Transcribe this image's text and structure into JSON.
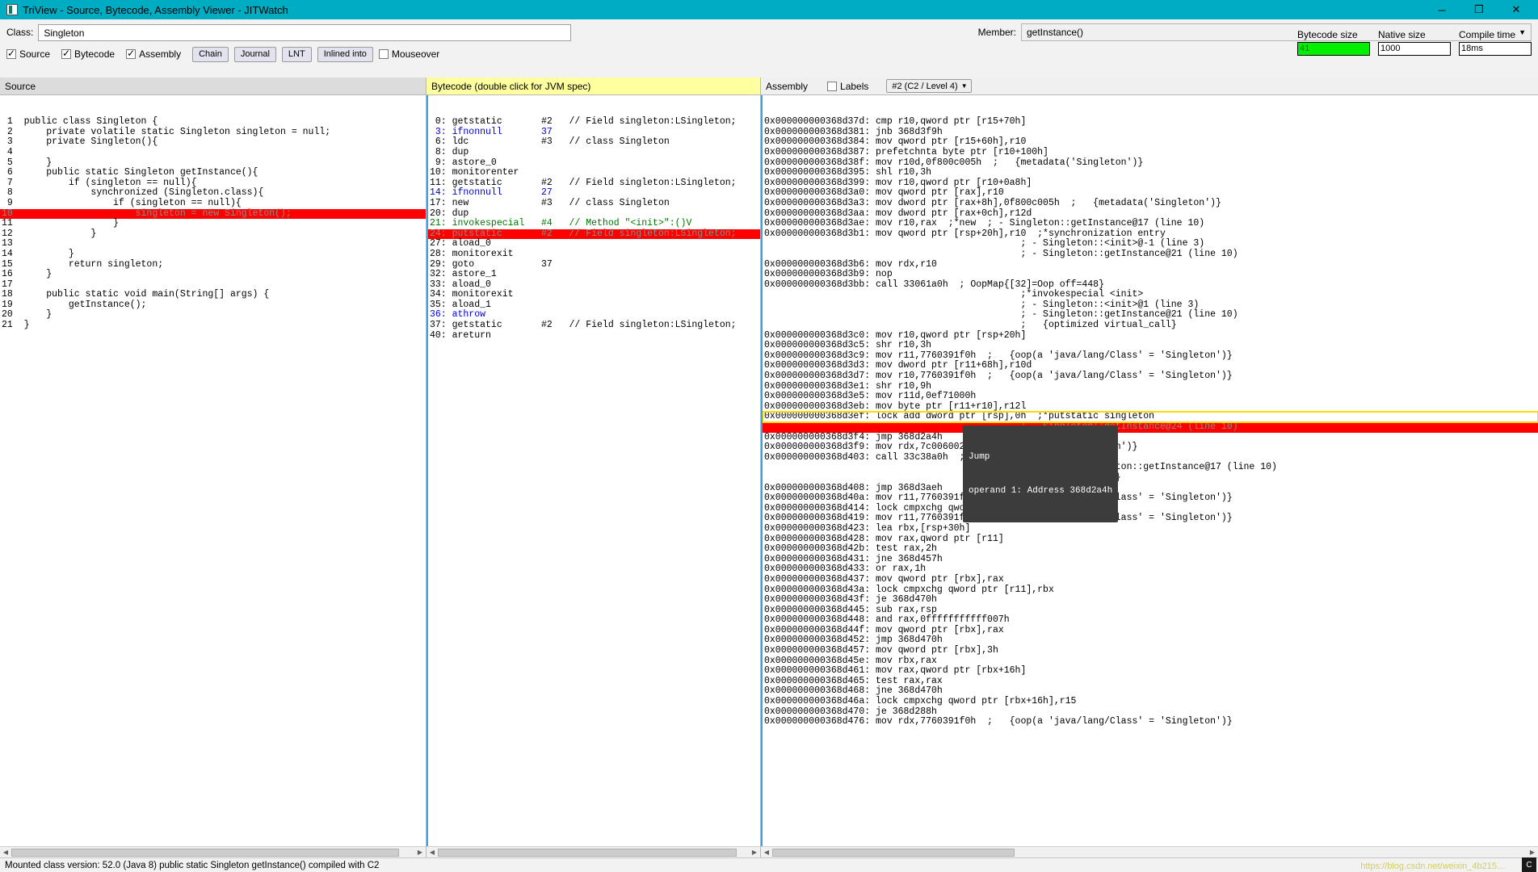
{
  "window": {
    "title": "TriView - Source, Bytecode, Assembly Viewer - JITWatch",
    "minimize": "─",
    "maximize": "❐",
    "close": "✕"
  },
  "toolbar": {
    "class_label": "Class:",
    "class_value": "Singleton",
    "member_label": "Member:",
    "member_value": "getInstance()",
    "member_arrow": "▼",
    "checkboxes": [
      {
        "label": "Source",
        "checked": true
      },
      {
        "label": "Bytecode",
        "checked": true
      },
      {
        "label": "Assembly",
        "checked": true
      }
    ],
    "mouseover": {
      "label": "Mouseover",
      "checked": false
    },
    "buttons": [
      "Chain",
      "Journal",
      "LNT",
      "Inlined into"
    ],
    "metrics": [
      {
        "label": "Bytecode size",
        "value": "41",
        "highlight": "#00f000"
      },
      {
        "label": "Native size",
        "value": "1000",
        "highlight": ""
      },
      {
        "label": "Compile time",
        "value": "18ms",
        "highlight": ""
      }
    ]
  },
  "source_panel": {
    "header": "Source",
    "highlight_line": 10,
    "lines": [
      {
        "n": "1",
        "text": "public class Singleton {"
      },
      {
        "n": "2",
        "text": "    private volatile static Singleton singleton = null;"
      },
      {
        "n": "3",
        "text": "    private Singleton(){"
      },
      {
        "n": "4",
        "text": ""
      },
      {
        "n": "5",
        "text": "    }"
      },
      {
        "n": "6",
        "text": "    public static Singleton getInstance(){"
      },
      {
        "n": "7",
        "text": "        if (singleton == null){"
      },
      {
        "n": "8",
        "text": "            synchronized (Singleton.class){"
      },
      {
        "n": "9",
        "text": "                if (singleton == null){"
      },
      {
        "n": "10",
        "text": "                    singleton = new Singleton();"
      },
      {
        "n": "11",
        "text": "                }"
      },
      {
        "n": "12",
        "text": "            }"
      },
      {
        "n": "13",
        "text": ""
      },
      {
        "n": "14",
        "text": "        }"
      },
      {
        "n": "15",
        "text": "        return singleton;"
      },
      {
        "n": "16",
        "text": "    }"
      },
      {
        "n": "17",
        "text": ""
      },
      {
        "n": "18",
        "text": "    public static void main(String[] args) {"
      },
      {
        "n": "19",
        "text": "        getInstance();"
      },
      {
        "n": "20",
        "text": "    }"
      },
      {
        "n": "21",
        "text": "}"
      }
    ]
  },
  "bytecode_panel": {
    "header": "Bytecode (double click for JVM spec)",
    "highlight_offset": "24",
    "lines": [
      {
        "offset": " 0:",
        "op": "getstatic",
        "arg": "#2",
        "comment": "// Field singleton:LSingleton;",
        "color": "black"
      },
      {
        "offset": " 3:",
        "op": "ifnonnull",
        "arg": "37",
        "comment": "",
        "color": "blue"
      },
      {
        "offset": " 6:",
        "op": "ldc",
        "arg": "#3",
        "comment": "// class Singleton",
        "color": "black"
      },
      {
        "offset": " 8:",
        "op": "dup",
        "arg": "",
        "comment": "",
        "color": "black"
      },
      {
        "offset": " 9:",
        "op": "astore_0",
        "arg": "",
        "comment": "",
        "color": "black"
      },
      {
        "offset": "10:",
        "op": "monitorenter",
        "arg": "",
        "comment": "",
        "color": "black"
      },
      {
        "offset": "11:",
        "op": "getstatic",
        "arg": "#2",
        "comment": "// Field singleton:LSingleton;",
        "color": "black"
      },
      {
        "offset": "14:",
        "op": "ifnonnull",
        "arg": "27",
        "comment": "",
        "color": "blue"
      },
      {
        "offset": "17:",
        "op": "new",
        "arg": "#3",
        "comment": "// class Singleton",
        "color": "black"
      },
      {
        "offset": "20:",
        "op": "dup",
        "arg": "",
        "comment": "",
        "color": "black"
      },
      {
        "offset": "21:",
        "op": "invokespecial",
        "arg": "#4",
        "comment": "// Method \"<init>\":()V",
        "color": "green"
      },
      {
        "offset": "24:",
        "op": "putstatic",
        "arg": "#2",
        "comment": "// Field singleton:LSingleton;",
        "color": "black",
        "highlight": true
      },
      {
        "offset": "27:",
        "op": "aload_0",
        "arg": "",
        "comment": "",
        "color": "black"
      },
      {
        "offset": "28:",
        "op": "monitorexit",
        "arg": "",
        "comment": "",
        "color": "black"
      },
      {
        "offset": "29:",
        "op": "goto",
        "arg": "37",
        "comment": "",
        "color": "black"
      },
      {
        "offset": "32:",
        "op": "astore_1",
        "arg": "",
        "comment": "",
        "color": "black"
      },
      {
        "offset": "33:",
        "op": "aload_0",
        "arg": "",
        "comment": "",
        "color": "black"
      },
      {
        "offset": "34:",
        "op": "monitorexit",
        "arg": "",
        "comment": "",
        "color": "black"
      },
      {
        "offset": "35:",
        "op": "aload_1",
        "arg": "",
        "comment": "",
        "color": "black"
      },
      {
        "offset": "36:",
        "op": "athrow",
        "arg": "",
        "comment": "",
        "color": "blue"
      },
      {
        "offset": "37:",
        "op": "getstatic",
        "arg": "#2",
        "comment": "// Field singleton:LSingleton;",
        "color": "black"
      },
      {
        "offset": "40:",
        "op": "areturn",
        "arg": "",
        "comment": "",
        "color": "black"
      }
    ]
  },
  "assembly_panel": {
    "header": "Assembly",
    "labels_checkbox": {
      "label": "Labels",
      "checked": false
    },
    "compilation_selector": "#2  (C2 / Level 4)",
    "selector_arrow": "▼",
    "highlight_yellow_address": "0x000000000368d3ef",
    "lines": [
      {
        "text": "0x000000000368d37d: cmp r10,qword ptr [r15+70h]",
        "clip_top": true
      },
      {
        "text": "0x000000000368d381: jnb 368d3f9h"
      },
      {
        "text": "0x000000000368d384: mov qword ptr [r15+60h],r10"
      },
      {
        "text": "0x000000000368d387: prefetchnta byte ptr [r10+100h]"
      },
      {
        "text": "0x000000000368d38f: mov r10d,0f800c005h  ;   {metadata('Singleton')}"
      },
      {
        "text": "0x000000000368d395: shl r10,3h"
      },
      {
        "text": "0x000000000368d399: mov r10,qword ptr [r10+0a8h]"
      },
      {
        "text": "0x000000000368d3a0: mov qword ptr [rax],r10"
      },
      {
        "text": "0x000000000368d3a3: mov dword ptr [rax+8h],0f800c005h  ;   {metadata('Singleton')}"
      },
      {
        "text": "0x000000000368d3aa: mov dword ptr [rax+0ch],r12d"
      },
      {
        "text": "0x000000000368d3ae: mov r10,rax  ;*new  ; - Singleton::getInstance@17 (line 10)"
      },
      {
        "text": "0x000000000368d3b1: mov qword ptr [rsp+20h],r10  ;*synchronization entry"
      },
      {
        "text": "                                              ; - Singleton::<init>@-1 (line 3)"
      },
      {
        "text": "                                              ; - Singleton::getInstance@21 (line 10)"
      },
      {
        "text": "0x000000000368d3b6: mov rdx,r10"
      },
      {
        "text": "0x000000000368d3b9: nop"
      },
      {
        "text": "0x000000000368d3bb: call 33061a0h  ; OopMap{[32]=Oop off=448}"
      },
      {
        "text": "                                              ;*invokespecial <init>"
      },
      {
        "text": "                                              ; - Singleton::<init>@1 (line 3)"
      },
      {
        "text": "                                              ; - Singleton::getInstance@21 (line 10)"
      },
      {
        "text": "                                              ;   {optimized virtual_call}"
      },
      {
        "text": "0x000000000368d3c0: mov r10,qword ptr [rsp+20h]"
      },
      {
        "text": "0x000000000368d3c5: shr r10,3h"
      },
      {
        "text": "0x000000000368d3c9: mov r11,7760391f0h  ;   {oop(a 'java/lang/Class' = 'Singleton')}"
      },
      {
        "text": "0x000000000368d3d3: mov dword ptr [r11+68h],r10d"
      },
      {
        "text": "0x000000000368d3d7: mov r10,7760391f0h  ;   {oop(a 'java/lang/Class' = 'Singleton')}"
      },
      {
        "text": "0x000000000368d3e1: shr r10,9h"
      },
      {
        "text": "0x000000000368d3e5: mov r11d,0ef71000h"
      },
      {
        "text": "0x000000000368d3eb: mov byte ptr [r11+r10],r12l"
      },
      {
        "text": "0x000000000368d3ef: lock add dword ptr [rsp],0h  ;*putstatic singleton",
        "yellow": true
      },
      {
        "text": "                                              ; - Singleton::getInstance@24 (line 10)",
        "red": true
      },
      {
        "text": "0x000000000368d3f4: jmp 368d2a4h"
      },
      {
        "text": "0x000000000368d3f9: mov rdx,7c0060028h  ;   {metadata('Singleton')}"
      },
      {
        "text": "0x000000000368d403: call 33c38a0h  ; OopMap{off=712}"
      },
      {
        "text": "                                              ;*new  ; - Singleton::getInstance@17 (line 10)"
      },
      {
        "text": "                                              ;   {runtime_call}"
      },
      {
        "text": "0x000000000368d408: jmp 368d3aeh"
      },
      {
        "text": "0x000000000368d40a: mov r11,7760391f0h  ;   {oop(a 'java/lang/Class' = 'Singleton')}"
      },
      {
        "text": "0x000000000368d414: lock cmpxchg qword ptr [r11],r10"
      },
      {
        "text": "0x000000000368d419: mov r11,7760391f0h  ;   {oop(a 'java/lang/Class' = 'Singleton')}"
      },
      {
        "text": "0x000000000368d423: lea rbx,[rsp+30h]"
      },
      {
        "text": "0x000000000368d428: mov rax,qword ptr [r11]"
      },
      {
        "text": "0x000000000368d42b: test rax,2h"
      },
      {
        "text": "0x000000000368d431: jne 368d457h"
      },
      {
        "text": "0x000000000368d433: or rax,1h"
      },
      {
        "text": "0x000000000368d437: mov qword ptr [rbx],rax"
      },
      {
        "text": "0x000000000368d43a: lock cmpxchg qword ptr [r11],rbx"
      },
      {
        "text": "0x000000000368d43f: je 368d470h"
      },
      {
        "text": "0x000000000368d445: sub rax,rsp"
      },
      {
        "text": "0x000000000368d448: and rax,0fffffffffff007h"
      },
      {
        "text": "0x000000000368d44f: mov qword ptr [rbx],rax"
      },
      {
        "text": "0x000000000368d452: jmp 368d470h"
      },
      {
        "text": "0x000000000368d457: mov qword ptr [rbx],3h"
      },
      {
        "text": "0x000000000368d45e: mov rbx,rax"
      },
      {
        "text": "0x000000000368d461: mov rax,qword ptr [rbx+16h]"
      },
      {
        "text": "0x000000000368d465: test rax,rax"
      },
      {
        "text": "0x000000000368d468: jne 368d470h"
      },
      {
        "text": "0x000000000368d46a: lock cmpxchg qword ptr [rbx+16h],r15"
      },
      {
        "text": "0x000000000368d470: je 368d288h"
      },
      {
        "text": "0x000000000368d476: mov rdx,7760391f0h  ;   {oop(a 'java/lang/Class' = 'Singleton')}",
        "clip_bottom": true
      }
    ],
    "tooltip": {
      "title": "Jump",
      "body": "operand 1: Address 368d2a4h"
    }
  },
  "statusbar": {
    "text": "Mounted class version: 52.0 (Java 8) public static Singleton getInstance() compiled with C2",
    "watermark": "https://blog.csdn.net/weixin_4b215…",
    "badge": "C"
  }
}
